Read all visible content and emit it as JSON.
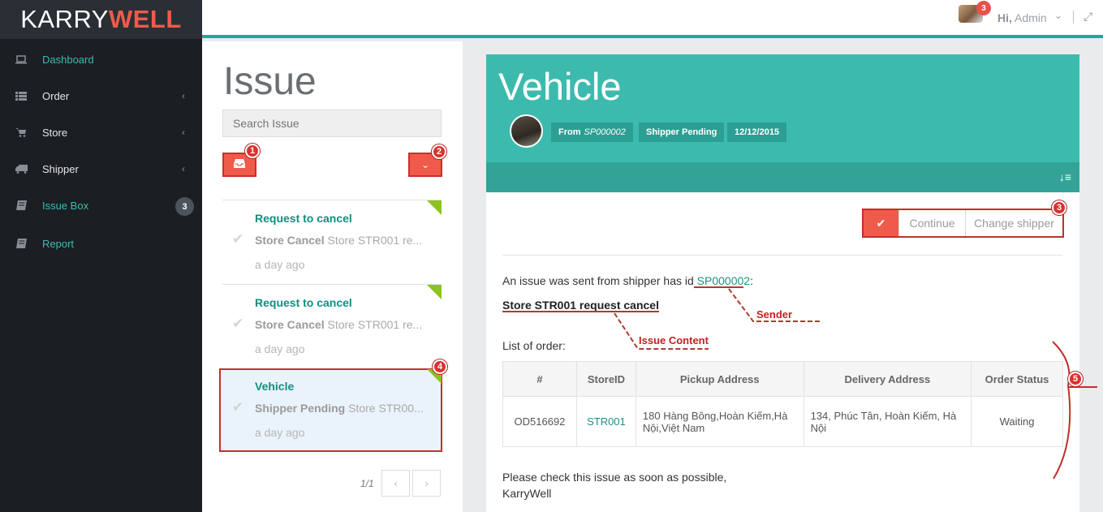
{
  "brand": {
    "part1": "KARRY",
    "part2": "WELL"
  },
  "sidebar": {
    "items": [
      {
        "label": "Dashboard",
        "icon": "laptop-icon"
      },
      {
        "label": "Order",
        "icon": "list-icon"
      },
      {
        "label": "Store",
        "icon": "cart-icon"
      },
      {
        "label": "Shipper",
        "icon": "truck-icon"
      },
      {
        "label": "Issue Box",
        "icon": "book-icon",
        "badge": "3"
      },
      {
        "label": "Report",
        "icon": "book-icon"
      }
    ]
  },
  "topbar": {
    "notifications": "3",
    "greeting_hi": "Hi,",
    "greeting_name": "Admin"
  },
  "issue_list": {
    "heading": "Issue",
    "search_placeholder": "Search Issue",
    "cards": [
      {
        "title": "Request to cancel",
        "subject": "Store Cancel",
        "preview": "Store STR001 re...",
        "time": "a day ago"
      },
      {
        "title": "Request to cancel",
        "subject": "Store Cancel",
        "preview": "Store STR001 re...",
        "time": "a day ago"
      },
      {
        "title": "Vehicle",
        "subject": "Shipper Pending",
        "preview": "Store STR00...",
        "time": "a day ago"
      }
    ],
    "pager": "1/1",
    "prev": "‹",
    "next": "›"
  },
  "detail": {
    "title": "Vehicle",
    "from_label": "From",
    "from_id": "SP000002",
    "status": "Shipper Pending",
    "date": "12/12/2015",
    "actions": {
      "continue": "Continue",
      "change_shipper": "Change shipper"
    },
    "intro_text": "An issue was sent from shipper has id",
    "shipper_id": "SP000002",
    "intro_suffix": ":",
    "content": "Store STR001 request cancel",
    "list_label": "List of order:",
    "table": {
      "headers": [
        "#",
        "StoreID",
        "Pickup Address",
        "Delivery Address",
        "Order Status"
      ],
      "rows": [
        [
          "OD516692",
          "STR001",
          "180 Hàng Bông,Hoàn Kiếm,Hà Nội,Việt Nam",
          "134, Phúc Tân, Hoàn Kiếm, Hà Nội",
          "Waiting"
        ]
      ]
    },
    "footer_line1": "Please check this issue as soon as possible,",
    "footer_line2": "KarryWell"
  },
  "annotations": {
    "markers": [
      "1",
      "2",
      "3",
      "4",
      "5"
    ],
    "sender": "Sender",
    "issue_content": "Issue Content"
  },
  "colors": {
    "accent": "#3dbaae",
    "danger": "#f05a4a",
    "sidebar": "#1b1e23",
    "link": "#1f8f82"
  }
}
